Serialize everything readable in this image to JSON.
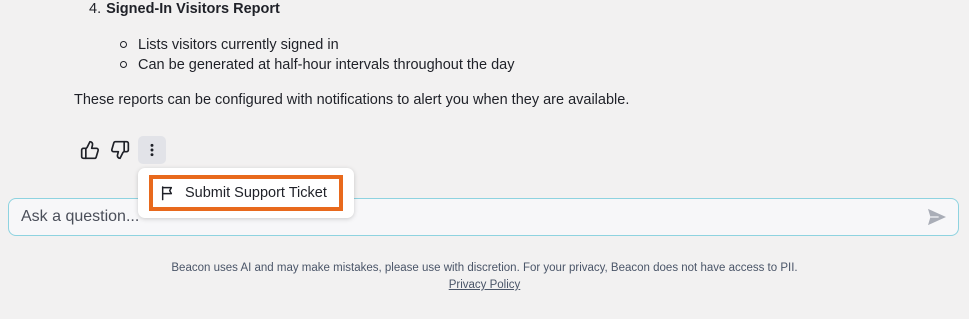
{
  "report": {
    "number": "4.",
    "title": "Signed-In Visitors Report",
    "bullets": [
      "Lists visitors currently signed in",
      "Can be generated at half-hour intervals throughout the day"
    ]
  },
  "summary": "These reports can be configured with notifications to alert you when they are available.",
  "feedback": {
    "icons": [
      "thumbs-up-icon",
      "thumbs-down-icon",
      "more-vertical-icon"
    ]
  },
  "menu": {
    "items": [
      {
        "label": "Submit Support Ticket",
        "icon": "flag-icon"
      }
    ]
  },
  "ask": {
    "placeholder": "Ask a question...",
    "value": ""
  },
  "footer": {
    "disclaimer": "Beacon uses AI and may make mistakes, please use with discretion. For your privacy, Beacon does not have access to PII.",
    "privacy_link": "Privacy Policy"
  },
  "colors": {
    "background": "#f2f1f1",
    "highlight": "#e8691c",
    "input_border": "#8ed3e0"
  }
}
